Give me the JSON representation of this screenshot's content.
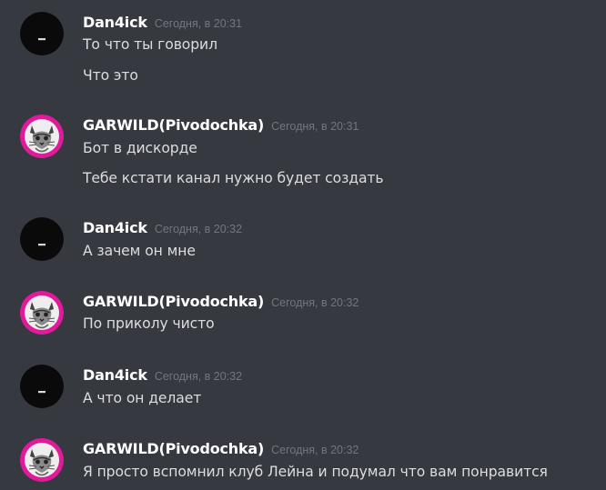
{
  "colors": {
    "background": "#36393f",
    "username": "#ffffff",
    "timestamp": "#72767d",
    "message": "#dcddde",
    "avatar_pink": "#e3199c"
  },
  "messages": [
    {
      "author": "Dan4ick",
      "avatar_icon": "dark-avatar-icon",
      "timestamp": "Сегодня, в 20:31",
      "lines": [
        "То что ты говорил",
        "Что это"
      ]
    },
    {
      "author": "GARWILD(Pivodochka)",
      "avatar_icon": "cat-avatar-icon",
      "timestamp": "Сегодня, в 20:31",
      "lines": [
        "Бот в дискорде",
        "Тебе кстати канал нужно будет создать"
      ]
    },
    {
      "author": "Dan4ick",
      "avatar_icon": "dark-avatar-icon",
      "timestamp": "Сегодня, в 20:32",
      "lines": [
        "А зачем он мне"
      ]
    },
    {
      "author": "GARWILD(Pivodochka)",
      "avatar_icon": "cat-avatar-icon",
      "timestamp": "Сегодня, в 20:32",
      "lines": [
        "По приколу чисто"
      ]
    },
    {
      "author": "Dan4ick",
      "avatar_icon": "dark-avatar-icon",
      "timestamp": "Сегодня, в 20:32",
      "lines": [
        "А что он делает"
      ]
    },
    {
      "author": "GARWILD(Pivodochka)",
      "avatar_icon": "cat-avatar-icon",
      "timestamp": "Сегодня, в 20:32",
      "lines": [
        "Я просто вспомнил клуб Лейна и подумал что вам понравится"
      ]
    }
  ]
}
